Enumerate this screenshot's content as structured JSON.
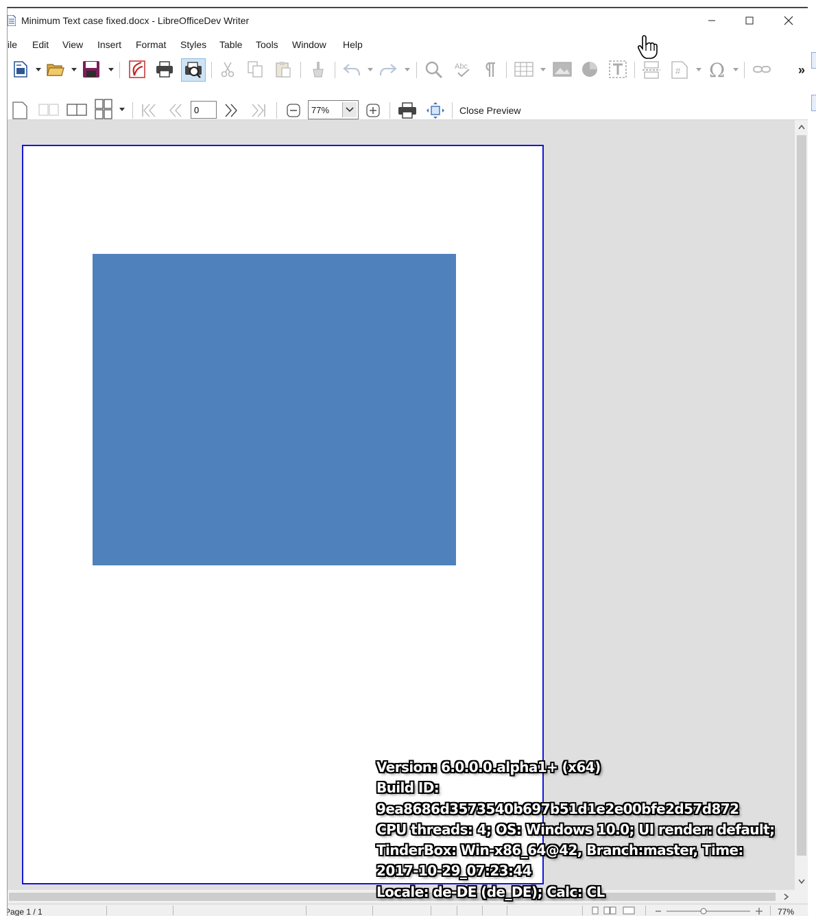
{
  "window": {
    "title": "Minimum Text case fixed.docx - LibreOfficeDev Writer"
  },
  "menu": [
    {
      "label": "ile"
    },
    {
      "label": "Edit"
    },
    {
      "label": "View"
    },
    {
      "label": "Insert"
    },
    {
      "label": "Format"
    },
    {
      "label": "Styles"
    },
    {
      "label": "Table"
    },
    {
      "label": "Tools"
    },
    {
      "label": "Window"
    },
    {
      "label": "Help"
    }
  ],
  "toolbar1": {
    "more_label": "»"
  },
  "preview_toolbar": {
    "page_number": "0",
    "zoom_value": "77%",
    "close_preview_label": "Close Preview"
  },
  "document": {
    "shape_color": "#4f81bd",
    "page_border_color": "#1515d6"
  },
  "statusbar": {
    "page_label": "Page 1 / 1",
    "zoom_label": "77%"
  },
  "overlay": {
    "lines": [
      "Version: 6.0.0.0.alpha1+ (x64)",
      "Build ID:",
      "9ea8686d3573540b697b51d1e2e00bfe2d57d872",
      "CPU threads: 4; OS: Windows 10.0; UI render: default;",
      "TinderBox: Win-x86_64@42, Branch:master, Time:",
      "2017-10-29_07:23:44",
      "Locale: de-DE (de_DE); Calc: CL"
    ]
  }
}
